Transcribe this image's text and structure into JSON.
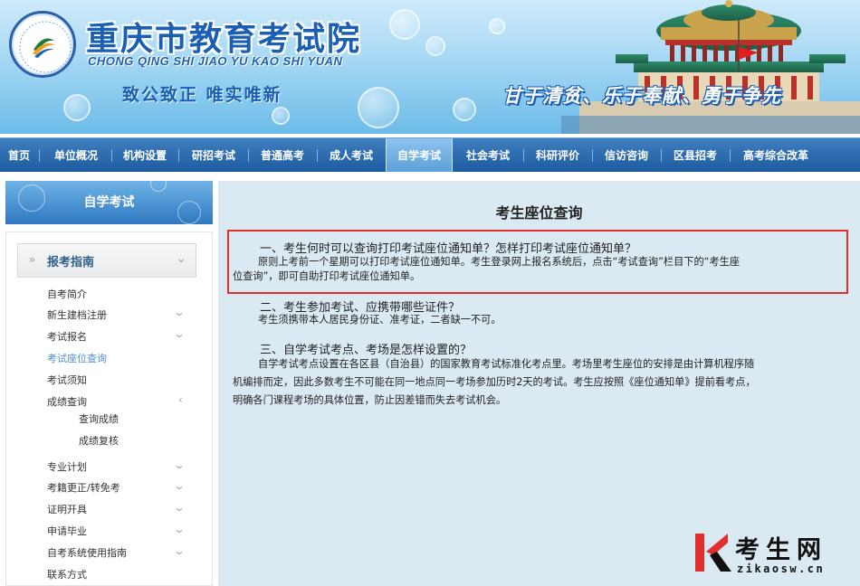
{
  "header": {
    "title": "重庆市教育考试院",
    "pinyin": "CHONG QING SHI JIAO YU KAO SHI YUAN",
    "motto": "致公致正    唯实唯新",
    "slogan": "甘于清贫、乐于奉献、勇于争先",
    "logo_icon": "exam-authority-logo",
    "building_icon": "great-hall-building"
  },
  "nav": {
    "items": [
      {
        "label": "首页"
      },
      {
        "label": "单位概况"
      },
      {
        "label": "机构设置"
      },
      {
        "label": "研招考试"
      },
      {
        "label": "普通高考"
      },
      {
        "label": "成人考试"
      },
      {
        "label": "自学考试",
        "active": true
      },
      {
        "label": "社会考试"
      },
      {
        "label": "科研评价"
      },
      {
        "label": "信访咨询"
      },
      {
        "label": "区县招考"
      },
      {
        "label": "高考综合改革"
      }
    ]
  },
  "sidebar": {
    "heading": "自学考试",
    "section": "报考指南",
    "items": [
      {
        "label": "自考简介"
      },
      {
        "label": "新生建档注册"
      },
      {
        "label": "考试报名"
      },
      {
        "label": "考试座位查询",
        "active": true
      },
      {
        "label": "考试须知"
      },
      {
        "label": "成绩查询"
      },
      {
        "label": "查询成绩",
        "sub": true
      },
      {
        "label": "成绩复核",
        "sub": true
      },
      {
        "label": "专业计划"
      },
      {
        "label": "考籍更正/转免考"
      },
      {
        "label": "证明开具"
      },
      {
        "label": "申请毕业"
      },
      {
        "label": "自考系统使用指南"
      },
      {
        "label": "联系方式"
      }
    ]
  },
  "main": {
    "title": "考生座位查询",
    "q1": "一、考生何时可以查询打印考试座位通知单？怎样打印考试座位通知单？",
    "a1_line1": "原则上考前一个星期可以打印考试座位通知单。考生登录网上报名系统后，点击“考试查询”栏目下的“考生座",
    "a1_line2": "位查询”，即可自助打印考试座位通知单。",
    "q2": "二、考生参加考试、应携带哪些证件？",
    "a2": "考生须携带本人居民身份证、准考证，二者缺一不可。",
    "q3": "三、自学考试考点、考场是怎样设置的？",
    "a3_line1": "自学考试考点设置在各区县（自治县）的国家教育考试标准化考点里。考场里考生座位的安排是由计算机程序随",
    "a3_line2": "机编排而定，因此多数考生不可能在同一地点同一考场参加历时2天的考试。考生应按照《座位通知单》提前看考点，",
    "a3_line3": "明确各门课程考场的具体位置，防止因差错而失去考试机会。"
  },
  "watermark": {
    "logo_letter": "K",
    "name": "考生网",
    "url": "zikaosw.cn"
  },
  "colors": {
    "nav_bg": "#1c5b9f",
    "nav_active": "#5a9fd8",
    "content_bg": "#dbe9f3",
    "highlight_border": "#e0302e",
    "sidebar_active": "#4e90d0",
    "title_blue": "#1a5fb4"
  }
}
